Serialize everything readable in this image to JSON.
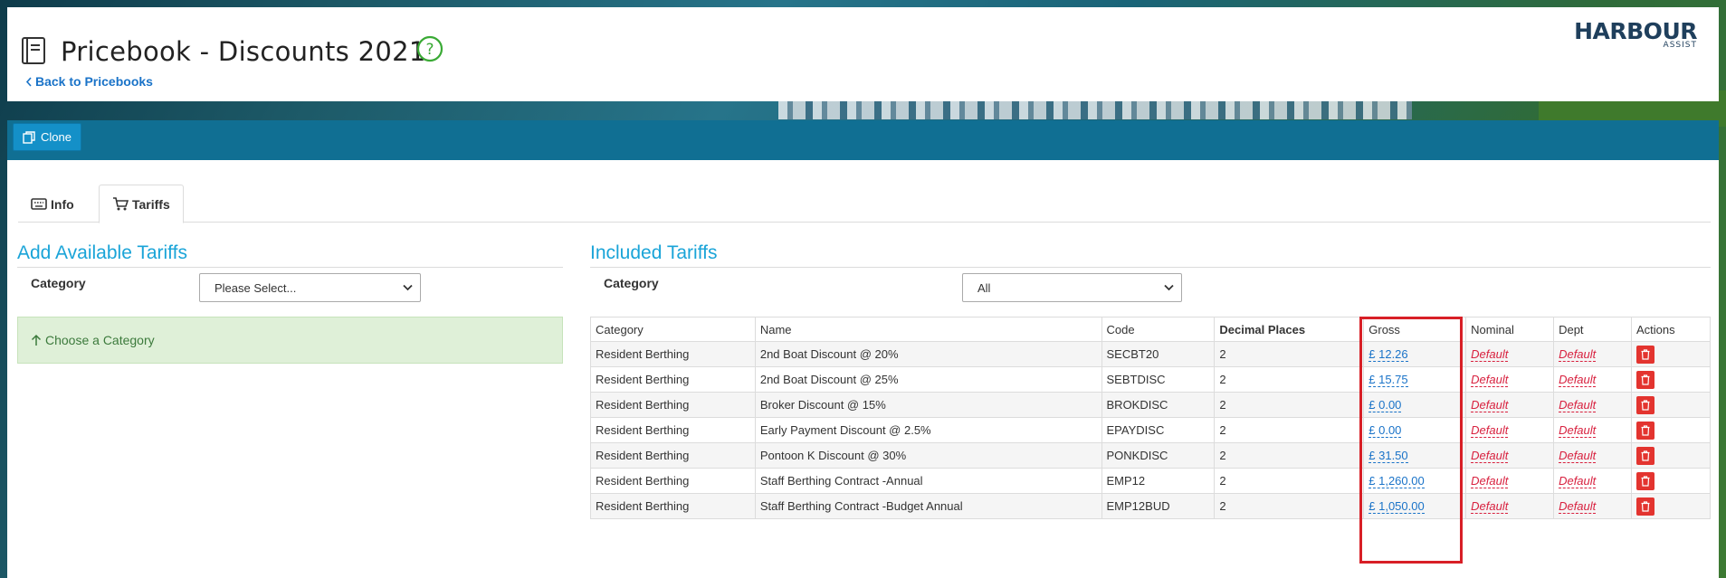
{
  "header": {
    "title": "Pricebook - Discounts 2021",
    "back_link": "Back to Pricebooks",
    "logo_main": "HARBOUR",
    "logo_sub": "ASSIST"
  },
  "toolbar": {
    "clone_label": "Clone"
  },
  "tabs": [
    {
      "label": "Info",
      "icon": "keyboard-icon"
    },
    {
      "label": "Tariffs",
      "icon": "cart-icon",
      "active": true
    }
  ],
  "available": {
    "title": "Add Available Tariffs",
    "category_label": "Category",
    "category_value": "Please Select...",
    "choose_msg": "Choose a Category"
  },
  "included": {
    "title": "Included Tariffs",
    "category_label": "Category",
    "category_value": "All",
    "columns": [
      "Category",
      "Name",
      "Code",
      "Decimal Places",
      "Gross",
      "Nominal",
      "Dept",
      "Actions"
    ],
    "rows": [
      {
        "category": "Resident Berthing",
        "name": "2nd Boat Discount @ 20%",
        "code": "SECBT20",
        "decimals": "2",
        "gross": "£ 12.26",
        "nominal": "Default",
        "dept": "Default"
      },
      {
        "category": "Resident Berthing",
        "name": "2nd Boat Discount @ 25%",
        "code": "SEBTDISC",
        "decimals": "2",
        "gross": "£ 15.75",
        "nominal": "Default",
        "dept": "Default"
      },
      {
        "category": "Resident Berthing",
        "name": "Broker Discount @ 15%",
        "code": "BROKDISC",
        "decimals": "2",
        "gross": "£ 0.00",
        "nominal": "Default",
        "dept": "Default"
      },
      {
        "category": "Resident Berthing",
        "name": "Early Payment Discount @ 2.5%",
        "code": "EPAYDISC",
        "decimals": "2",
        "gross": "£ 0.00",
        "nominal": "Default",
        "dept": "Default"
      },
      {
        "category": "Resident Berthing",
        "name": "Pontoon K Discount @ 30%",
        "code": "PONKDISC",
        "decimals": "2",
        "gross": "£ 31.50",
        "nominal": "Default",
        "dept": "Default"
      },
      {
        "category": "Resident Berthing",
        "name": "Staff Berthing Contract -Annual",
        "code": "EMP12",
        "decimals": "2",
        "gross": "£ 1,260.00",
        "nominal": "Default",
        "dept": "Default"
      },
      {
        "category": "Resident Berthing",
        "name": "Staff Berthing Contract -Budget Annual",
        "code": "EMP12BUD",
        "decimals": "2",
        "gross": "£ 1,050.00",
        "nominal": "Default",
        "dept": "Default"
      }
    ]
  },
  "colors": {
    "accent": "#1aa4d8",
    "toolbar": "#106f93",
    "danger": "#e3342f",
    "link": "#1a73c8",
    "highlight": "#d81f26"
  }
}
